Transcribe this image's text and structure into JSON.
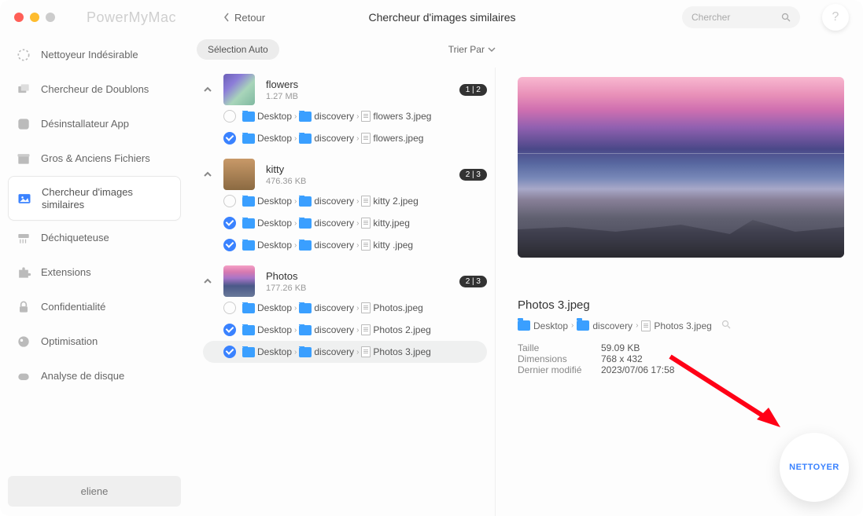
{
  "app_name": "PowerMyMac",
  "back_label": "Retour",
  "page_title": "Chercheur d'images similaires",
  "search_placeholder": "Chercher",
  "help_label": "?",
  "sidebar": {
    "items": [
      {
        "label": "Nettoyeur Indésirable"
      },
      {
        "label": "Chercheur de Doublons"
      },
      {
        "label": "Désinstallateur App"
      },
      {
        "label": "Gros & Anciens Fichiers"
      },
      {
        "label": "Chercheur d'images similaires"
      },
      {
        "label": "Déchiqueteuse"
      },
      {
        "label": "Extensions"
      },
      {
        "label": "Confidentialité"
      },
      {
        "label": "Optimisation"
      },
      {
        "label": "Analyse de disque"
      }
    ],
    "user": "eliene"
  },
  "toolbar": {
    "auto_select": "Sélection Auto",
    "sort_by": "Trier Par"
  },
  "path_labels": {
    "desktop": "Desktop",
    "discovery": "discovery"
  },
  "groups": [
    {
      "name": "flowers",
      "size": "1.27 MB",
      "badge": "1 | 2",
      "files": [
        {
          "name": "flowers 3.jpeg",
          "checked": false
        },
        {
          "name": "flowers.jpeg",
          "checked": true
        }
      ]
    },
    {
      "name": "kitty",
      "size": "476.36 KB",
      "badge": "2 | 3",
      "files": [
        {
          "name": "kitty 2.jpeg",
          "checked": false
        },
        {
          "name": "kitty.jpeg",
          "checked": true
        },
        {
          "name": "kitty .jpeg",
          "checked": true
        }
      ]
    },
    {
      "name": "Photos",
      "size": "177.26 KB",
      "badge": "2 | 3",
      "files": [
        {
          "name": "Photos.jpeg",
          "checked": false
        },
        {
          "name": "Photos 2.jpeg",
          "checked": true
        },
        {
          "name": "Photos 3.jpeg",
          "checked": true,
          "selected": true
        }
      ]
    }
  ],
  "detail": {
    "filename": "Photos 3.jpeg",
    "path_segments": [
      "Desktop",
      "discovery",
      "Photos 3.jpeg"
    ],
    "labels": {
      "size": "Taille",
      "dimensions": "Dimensions",
      "modified": "Dernier modifié"
    },
    "size": "59.09 KB",
    "dimensions": "768 x 432",
    "modified": "2023/07/06 17:58"
  },
  "clean_button": "NETTOYER"
}
